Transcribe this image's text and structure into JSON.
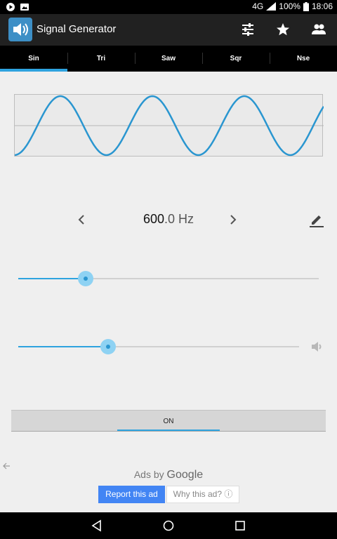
{
  "status_bar": {
    "network": "4G",
    "network_sup": "4G",
    "battery": "100%",
    "time": "18:06"
  },
  "app_bar": {
    "title": "Signal Generator",
    "icons": [
      "speaker-app-icon",
      "tune-icon",
      "star-icon",
      "people-icon"
    ]
  },
  "tabs": [
    {
      "label": "Sin",
      "active": true
    },
    {
      "label": "Tri",
      "active": false
    },
    {
      "label": "Saw",
      "active": false
    },
    {
      "label": "Sqr",
      "active": false
    },
    {
      "label": "Nse",
      "active": false
    }
  ],
  "frequency": {
    "integer": "600",
    "decimal": ".0",
    "unit": "Hz"
  },
  "sliders": {
    "frequency_level": 0.225,
    "volume_level": 0.32
  },
  "toggle": {
    "label": "ON"
  },
  "ads": {
    "ads_by": "Ads by",
    "google": "Google",
    "report": "Report this ad",
    "why": "Why this ad? ⓘ"
  },
  "colors": {
    "accent": "#2ea3df",
    "app_bar": "#212121",
    "ad_button": "#4285f4"
  }
}
